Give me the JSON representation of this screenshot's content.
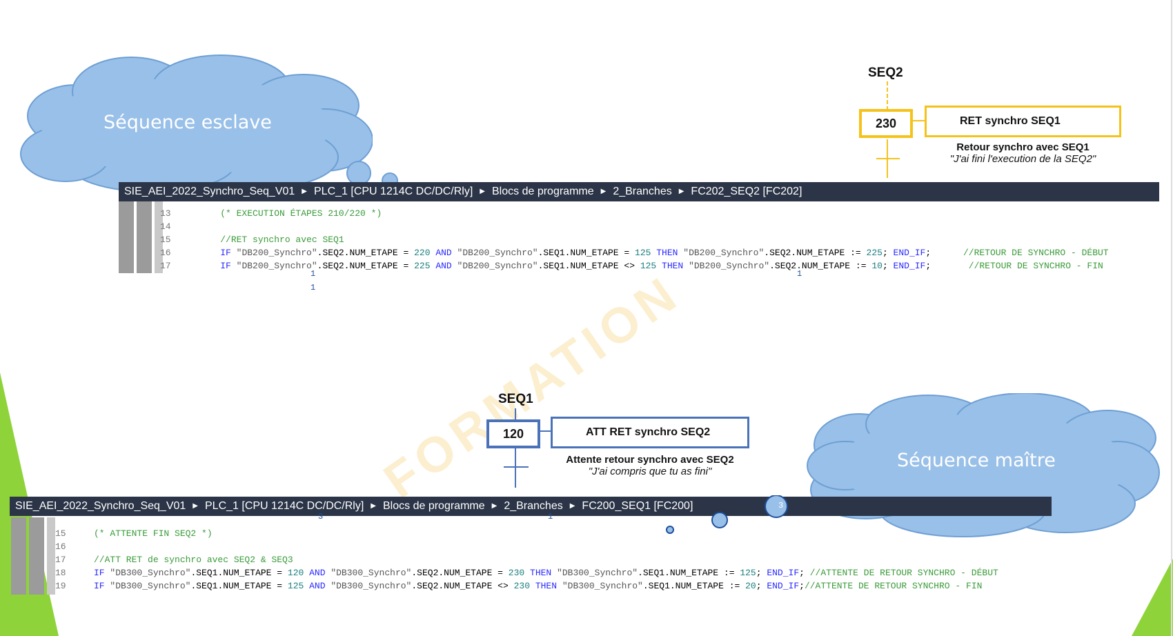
{
  "colors": {
    "accent_green": "#8fd33a",
    "cloud_blue": "#99c0e8",
    "cloud_border": "#6e9fd4",
    "seq2_box": "#f5c21a",
    "seq1_box": "#4a72b8",
    "toolbar_bg": "#2b3547"
  },
  "watermark": "FORMATION",
  "top": {
    "cloud_label": "Séquence esclave",
    "seq_title": "SEQ2",
    "step_number": "230",
    "action_label": "RET synchro SEQ1",
    "desc_line1": "Retour synchro avec SEQ1",
    "desc_line2": "\"J'ai fini l'execution de la SEQ2\"",
    "breadcrumb": [
      "SIE_AEI_2022_Synchro_Seq_V01",
      "PLC_1 [CPU 1214C DC/DC/Rly]",
      "Blocs de programme",
      "2_Branches",
      "FC202_SEQ2 [FC202]"
    ],
    "code_lines": [
      {
        "n": "13",
        "text": "    (* EXECUTION ÉTAPES 210/220 *)"
      },
      {
        "n": "14",
        "text": ""
      },
      {
        "n": "15",
        "text": "    //RET synchro avec SEQ1"
      },
      {
        "n": "16",
        "text": "    IF \"DB200_Synchro\".SEQ2.NUM_ETAPE = 220 AND \"DB200_Synchro\".SEQ1.NUM_ETAPE = 125 THEN \"DB200_Synchro\".SEQ2.NUM_ETAPE := 225; END_IF;      //RETOUR DE SYNCHRO - DÉBUT"
      },
      {
        "n": "17",
        "text": "    IF \"DB200_Synchro\".SEQ2.NUM_ETAPE = 225 AND \"DB200_Synchro\".SEQ1.NUM_ETAPE <> 125 THEN \"DB200_Synchro\".SEQ2.NUM_ETAPE := 10; END_IF;       //RETOUR DE SYNCHRO - FIN"
      }
    ],
    "markers": [
      "1",
      "1",
      "1"
    ]
  },
  "bottom": {
    "cloud_label": "Séquence maître",
    "seq_title": "SEQ1",
    "step_number": "120",
    "action_label": "ATT RET synchro SEQ2",
    "desc_line1": "Attente retour synchro avec SEQ2",
    "desc_line2": "\"J'ai compris que tu as fini\"",
    "breadcrumb": [
      "SIE_AEI_2022_Synchro_Seq_V01",
      "PLC_1 [CPU 1214C DC/DC/Rly]",
      "Blocs de programme",
      "2_Branches",
      "FC200_SEQ1 [FC200]"
    ],
    "code_lines": [
      {
        "n": "15",
        "text": "(* ATTENTE FIN SEQ2 *)"
      },
      {
        "n": "16",
        "text": ""
      },
      {
        "n": "17",
        "text": "//ATT RET de synchro avec SEQ2 & SEQ3"
      },
      {
        "n": "18",
        "text": "IF \"DB300_Synchro\".SEQ1.NUM_ETAPE = 120 AND \"DB300_Synchro\".SEQ2.NUM_ETAPE = 230 THEN \"DB300_Synchro\".SEQ1.NUM_ETAPE := 125; END_IF; //ATTENTE DE RETOUR SYNCHRO - DÉBUT"
      },
      {
        "n": "19",
        "text": "IF \"DB300_Synchro\".SEQ1.NUM_ETAPE = 125 AND \"DB300_Synchro\".SEQ2.NUM_ETAPE <> 230 THEN \"DB300_Synchro\".SEQ1.NUM_ETAPE := 20; END_IF;//ATTENTE DE RETOUR SYNCHRO - FIN"
      }
    ],
    "markers": [
      "3",
      "1",
      "3"
    ]
  }
}
